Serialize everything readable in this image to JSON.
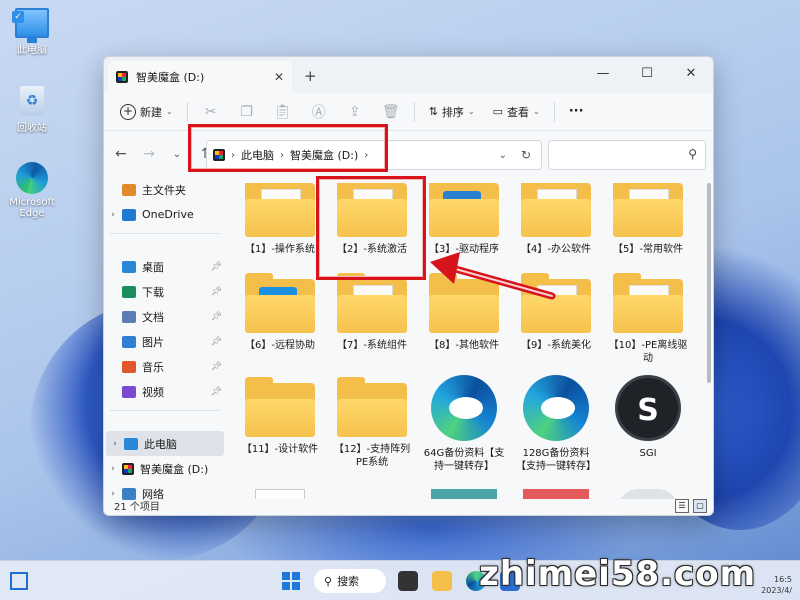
{
  "desktop": {
    "icons": [
      {
        "label": "此电脑"
      },
      {
        "label": "回收站"
      },
      {
        "label": "Microsoft Edge"
      }
    ]
  },
  "window": {
    "tab_title": "智美魔盒 (D:)",
    "new_tab": "+",
    "minimize": "—",
    "maximize": "☐",
    "close": "✕"
  },
  "toolbar": {
    "new_label": "新建",
    "sort_label": "排序",
    "view_label": "查看",
    "more_label": "···"
  },
  "address": {
    "crumbs": [
      "此电脑",
      "智美魔盒 (D:)"
    ],
    "search_placeholder": ""
  },
  "sidebar": {
    "items": [
      {
        "label": "主文件夹",
        "color": "#e08a2b"
      },
      {
        "label": "OneDrive",
        "color": "#1f78d1"
      },
      {
        "label": "桌面",
        "color": "#2a87d8"
      },
      {
        "label": "下载",
        "color": "#1c8e5d"
      },
      {
        "label": "文档",
        "color": "#5a7db6"
      },
      {
        "label": "图片",
        "color": "#2f7fd4"
      },
      {
        "label": "音乐",
        "color": "#e2572a"
      },
      {
        "label": "视频",
        "color": "#7a4bd0"
      },
      {
        "label": "此电脑",
        "color": "#2a87d8"
      },
      {
        "label": "智美魔盒 (D:)",
        "color": "#333333"
      },
      {
        "label": "网络",
        "color": "#3b7fc4"
      }
    ]
  },
  "files": [
    {
      "name": "【1】-操作系统"
    },
    {
      "name": "【2】-系统激活"
    },
    {
      "name": "【3】-驱动程序"
    },
    {
      "name": "【4】-办公软件"
    },
    {
      "name": "【5】-常用软件"
    },
    {
      "name": "【6】-远程协助"
    },
    {
      "name": "【7】-系统组件"
    },
    {
      "name": "【8】-其他软件"
    },
    {
      "name": "【9】-系统美化"
    },
    {
      "name": "【10】-PE离线驱动"
    },
    {
      "name": "【11】-设计软件"
    },
    {
      "name": "【12】-支持阵列PE系统"
    },
    {
      "name": "64G备份资料【支持一键转存】"
    },
    {
      "name": "128G备份资料【支持一键转存】"
    },
    {
      "name": "SGI",
      "icon_text": "S"
    }
  ],
  "status": {
    "count": "21 个项目"
  },
  "taskbar": {
    "search_label": "搜索",
    "watermark": "zhimei58.com",
    "clock_time": "16:5",
    "clock_date": "2023/4/"
  },
  "colors": {
    "highlight_red": "#d7141c",
    "folder_yellow": "#f3bf4a"
  }
}
